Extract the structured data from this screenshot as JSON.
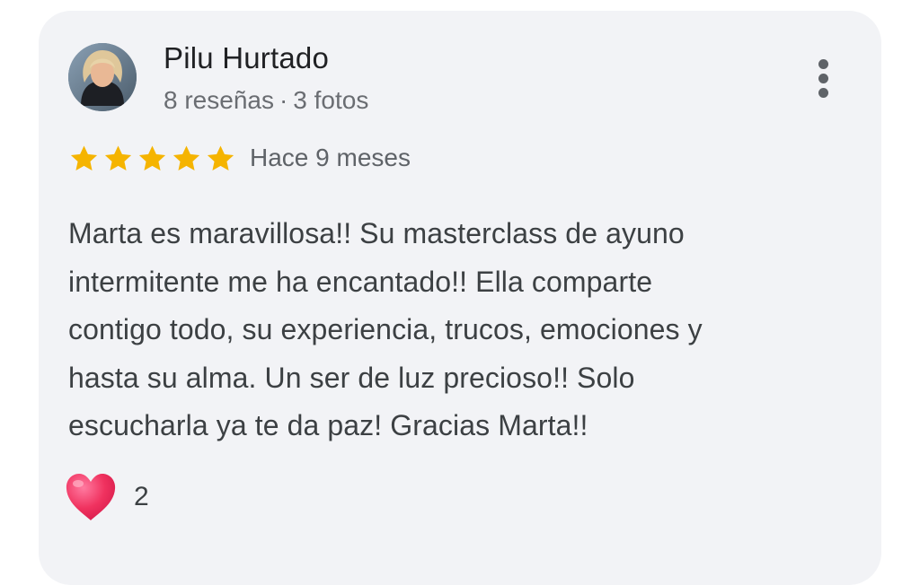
{
  "reviewer": {
    "name": "Pilu Hurtado",
    "reviews_count": "8 reseñas",
    "separator": "·",
    "photos_count": "3 fotos"
  },
  "rating": {
    "stars": 5,
    "max_stars": 5,
    "star_color": "#f5b400"
  },
  "time_ago": "Hace 9 meses",
  "review_text": "Marta es maravillosa!! Su masterclass de ayuno\nintermitente me ha encantado!! Ella comparte\ncontigo todo, su experiencia, trucos, emociones y\nhasta su alma. Un ser de luz precioso!! Solo\nescucharla ya te da paz! Gracias Marta!!",
  "reactions": {
    "icon": "heart-icon",
    "count": "2",
    "color": "#f0325f"
  },
  "menu": {
    "icon": "more-vert-icon"
  },
  "colors": {
    "card_background": "#f2f3f6",
    "text_primary": "#202124",
    "text_secondary": "#6a6d72"
  }
}
